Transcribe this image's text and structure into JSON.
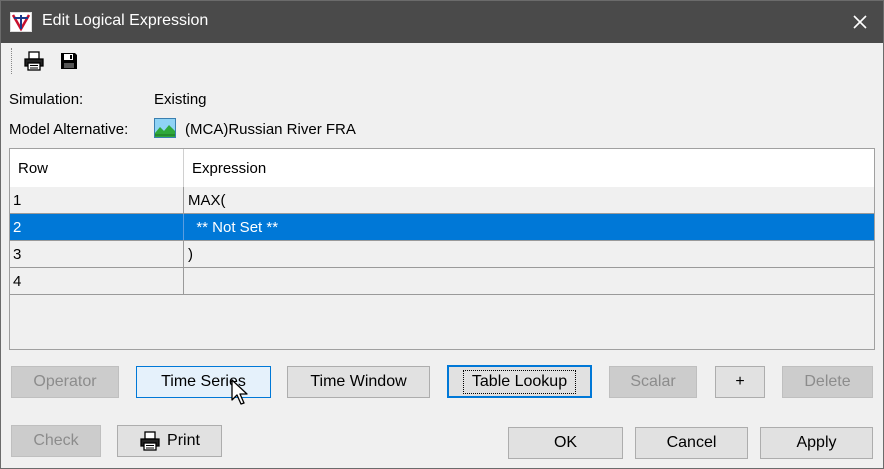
{
  "window": {
    "title": "Edit Logical Expression",
    "close_glyph": "✕",
    "icons": {
      "app": "app-logo-icon",
      "close": "close-icon"
    }
  },
  "toolbar": {
    "items": [
      {
        "name": "print-icon",
        "tooltip": ""
      },
      {
        "name": "save-icon",
        "tooltip": ""
      }
    ]
  },
  "info": {
    "simulation_label": "Simulation:",
    "simulation_value": "Existing",
    "model_label": "Model Alternative:",
    "model_value": "(MCA)Russian River FRA",
    "model_icon": "landscape-icon"
  },
  "table": {
    "columns": [
      "Row",
      "Expression"
    ],
    "rows": [
      {
        "row": "1",
        "expression": "MAX("
      },
      {
        "row": "2",
        "expression": "  ** Not Set **"
      },
      {
        "row": "3",
        "expression": ")"
      },
      {
        "row": "4",
        "expression": ""
      }
    ],
    "selected_row": 2
  },
  "buttons_row1": {
    "operator": "Operator",
    "time_series": "Time Series",
    "time_window": "Time Window",
    "table_lookup": "Table Lookup",
    "scalar": "Scalar",
    "plus": "+",
    "delete": "Delete"
  },
  "buttons_row2": {
    "check": "Check",
    "print": "Print",
    "ok": "OK",
    "cancel": "Cancel",
    "apply": "Apply"
  },
  "colors": {
    "titlebar": "#4a4a4a",
    "selection": "#0078d7",
    "dialog_bg": "#f0f0f0"
  }
}
